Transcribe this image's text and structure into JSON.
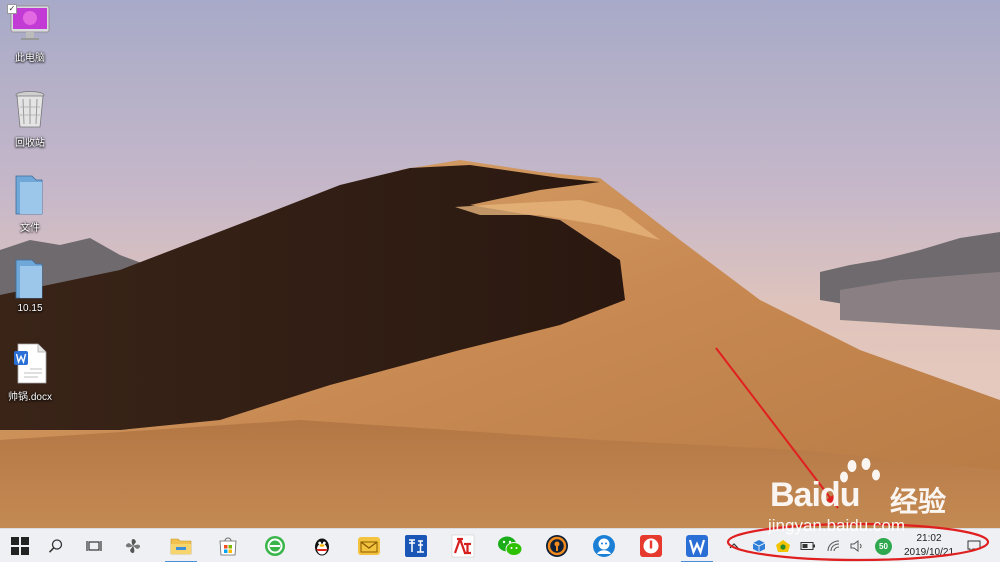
{
  "desktop": {
    "icons": [
      {
        "label": "此电脑"
      },
      {
        "label": "回收站"
      },
      {
        "label": "文件"
      },
      {
        "label": "10.15"
      },
      {
        "label": "帅锅.docx"
      }
    ]
  },
  "taskbar": {
    "apps": [
      {
        "icon": "windows-start-icon"
      },
      {
        "icon": "search-icon"
      },
      {
        "icon": "task-view-icon"
      },
      {
        "icon": "pinwheel-app-icon"
      },
      {
        "icon": "file-explorer-icon"
      },
      {
        "icon": "microsoft-store-icon"
      },
      {
        "icon": "green-browser-icon"
      },
      {
        "icon": "qq-penguin-icon"
      },
      {
        "icon": "mail-app-icon"
      },
      {
        "icon": "blue-tools-app-icon"
      },
      {
        "icon": "red-letters-app-icon"
      },
      {
        "icon": "wechat-icon"
      },
      {
        "icon": "orange-keyhole-app-icon"
      },
      {
        "icon": "blue-avatar-app-icon"
      },
      {
        "icon": "red-power-app-icon"
      },
      {
        "icon": "wps-office-icon"
      }
    ],
    "tray": {
      "battery_badge": "50",
      "time": "21:02",
      "date": "2019/10/21"
    }
  },
  "watermark": {
    "brand": "Bai",
    "brand_tail": "du",
    "cn": "经验",
    "url": "jingyan.baidu.com"
  },
  "colors": {
    "taskbar_bg": "#eef0f3",
    "annotation_red": "#e02020",
    "accent_blue": "#4a8fd8"
  }
}
